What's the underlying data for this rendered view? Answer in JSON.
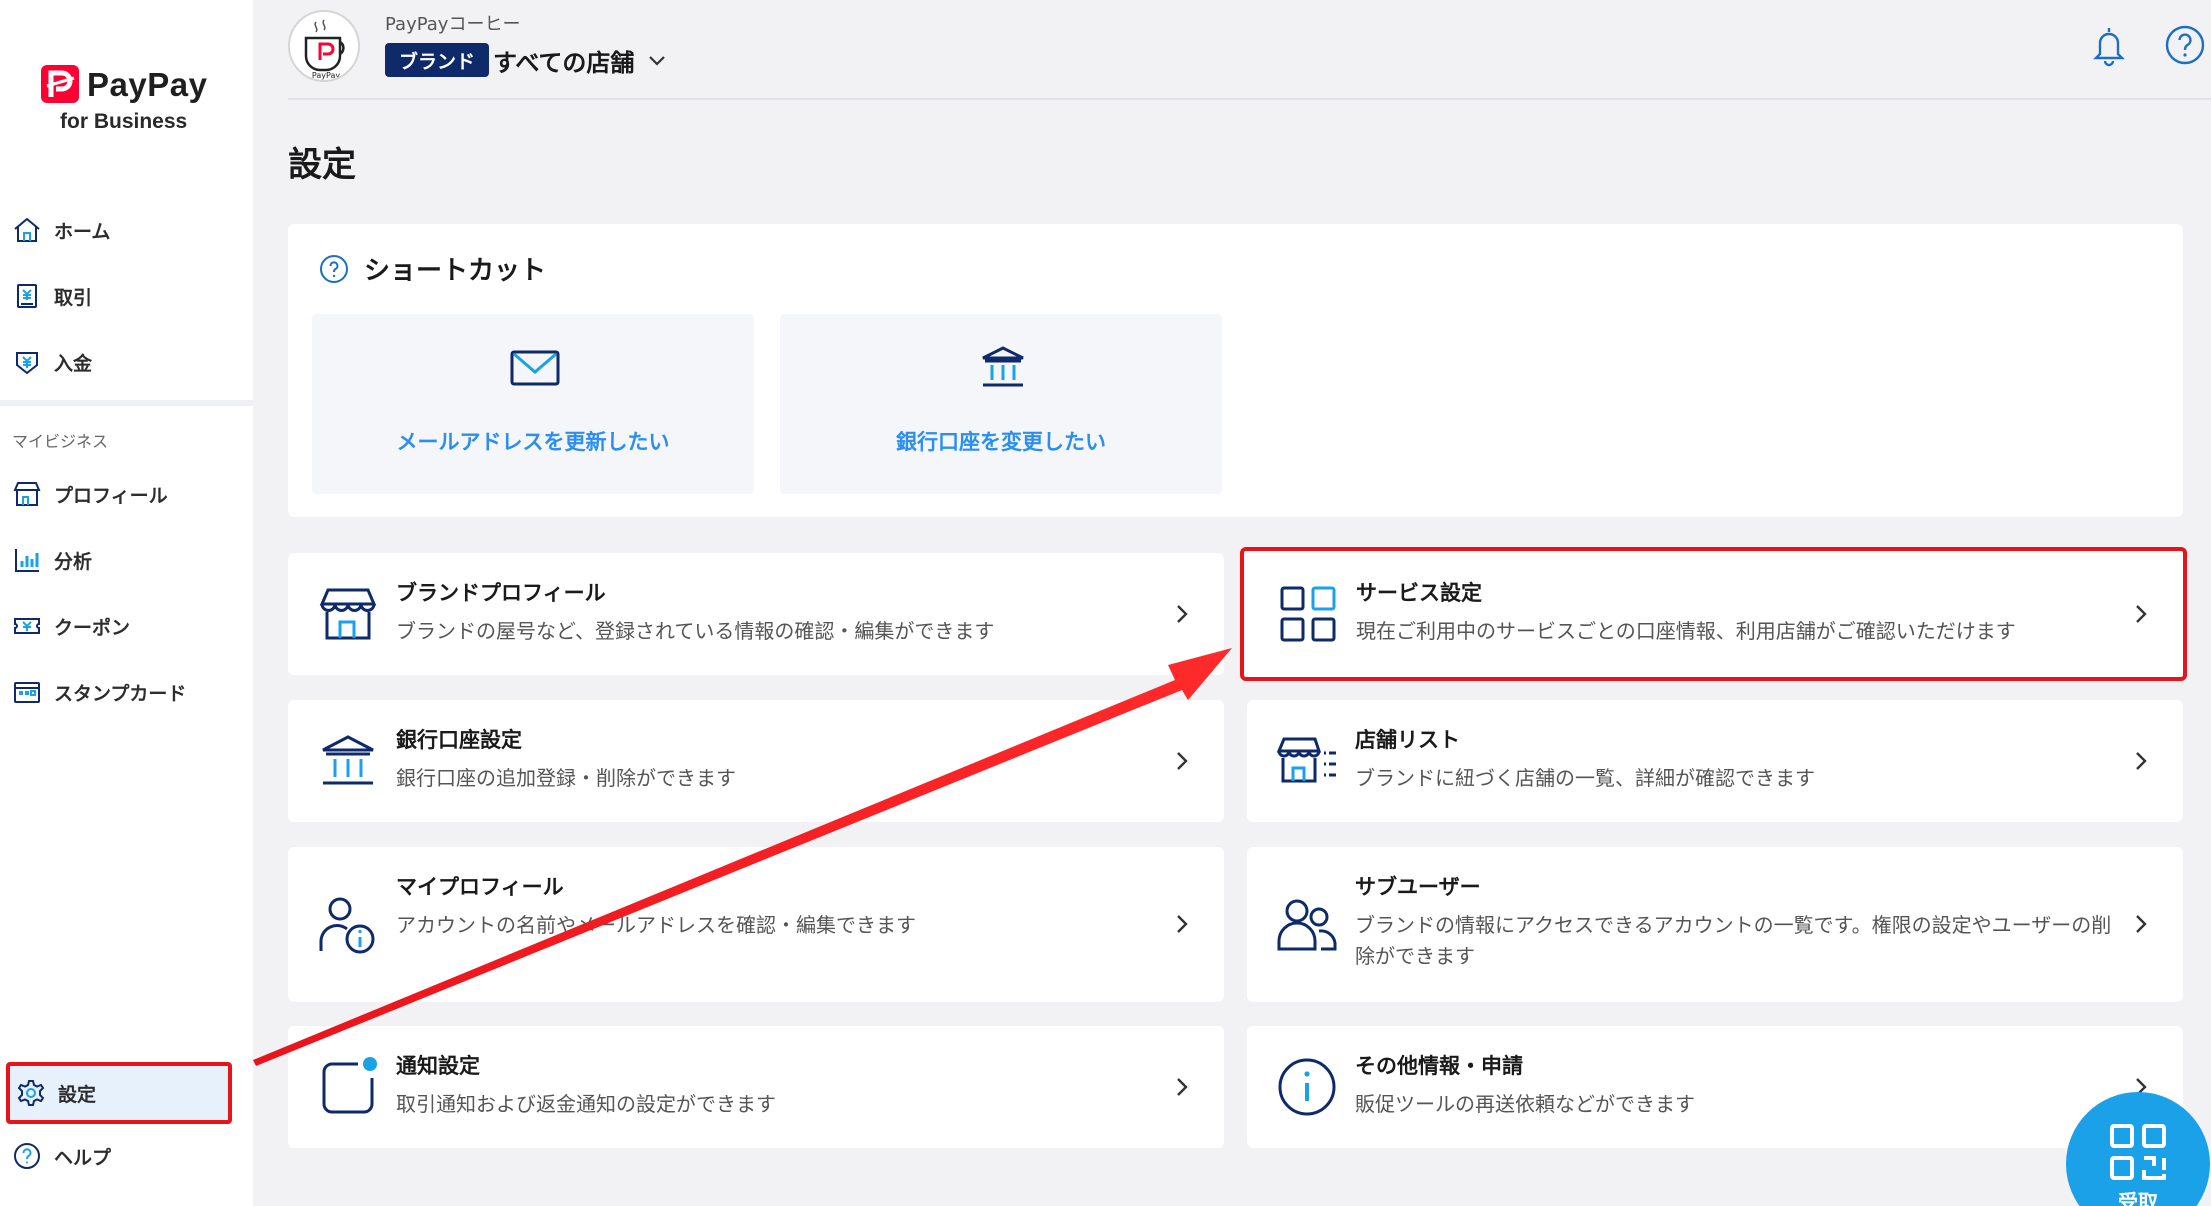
{
  "brand": {
    "logo_text": "PayPay",
    "logo_sub": "for Business"
  },
  "sidebar": {
    "items": [
      {
        "label": "ホーム"
      },
      {
        "label": "取引"
      },
      {
        "label": "入金"
      }
    ],
    "section_label": "マイビジネス",
    "business_items": [
      {
        "label": "プロフィール"
      },
      {
        "label": "分析"
      },
      {
        "label": "クーポン"
      },
      {
        "label": "スタンプカード"
      }
    ],
    "bottom_items": [
      {
        "label": "設定"
      },
      {
        "label": "ヘルプ"
      }
    ]
  },
  "header": {
    "store_logo_text": "PayPay",
    "brand_name": "PayPayコーヒー",
    "brand_badge": "ブランド",
    "store_selector": "すべての店舗"
  },
  "page": {
    "title": "設定"
  },
  "shortcut": {
    "title": "ショートカット",
    "tiles": [
      {
        "label": "メールアドレスを更新したい"
      },
      {
        "label": "銀行口座を変更したい"
      }
    ]
  },
  "cards": [
    {
      "title": "ブランドプロフィール",
      "desc": "ブランドの屋号など、登録されている情報の確認・編集ができます"
    },
    {
      "title": "サービス設定",
      "desc": "現在ご利用中のサービスごとの口座情報、利用店舗がご確認いただけます"
    },
    {
      "title": "銀行口座設定",
      "desc": "銀行口座の追加登録・削除ができます"
    },
    {
      "title": "店舗リスト",
      "desc": "ブランドに紐づく店舗の一覧、詳細が確認できます"
    },
    {
      "title": "マイプロフィール",
      "desc": "アカウントの名前やメールアドレスを確認・編集できます"
    },
    {
      "title": "サブユーザー",
      "desc": "ブランドの情報にアクセスできるアカウントの一覧です。権限の設定やユーザーの削除ができます"
    },
    {
      "title": "通知設定",
      "desc": "取引通知および返金通知の設定ができます"
    },
    {
      "title": "その他情報・申請",
      "desc": "販促ツールの再送依頼などができます"
    }
  ],
  "fab": {
    "label": "受取"
  },
  "colors": {
    "accent_blue": "#2b8ef0",
    "navy": "#0e2a6a",
    "highlight_red": "#e8141c",
    "brand_red": "#ff0033"
  }
}
